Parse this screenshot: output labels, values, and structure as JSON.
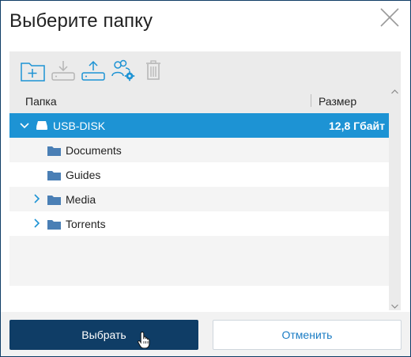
{
  "dialog": {
    "title": "Выберите папку",
    "close_icon": "close-icon"
  },
  "toolbar": {
    "icons": [
      "new-folder-icon",
      "download-icon",
      "upload-icon",
      "user-settings-icon",
      "trash-icon"
    ]
  },
  "table": {
    "columns": [
      "Папка",
      "Размер"
    ],
    "rows": [
      {
        "label": "USB-DISK",
        "size": "12,8 Гбайт",
        "icon": "drive-icon",
        "expanded": true,
        "selected": true,
        "level": 0
      },
      {
        "label": "Documents",
        "icon": "folder-icon",
        "level": 1
      },
      {
        "label": "Guides",
        "icon": "folder-icon",
        "level": 1
      },
      {
        "label": "Media",
        "icon": "folder-icon",
        "level": 1,
        "expandable": true
      },
      {
        "label": "Torrents",
        "icon": "folder-icon",
        "level": 1,
        "expandable": true
      }
    ]
  },
  "footer": {
    "primary_label": "Выбрать",
    "secondary_label": "Отменить"
  },
  "colors": {
    "accent": "#0f3d66",
    "selection": "#1d93d4",
    "folder": "#4a7fb5"
  }
}
